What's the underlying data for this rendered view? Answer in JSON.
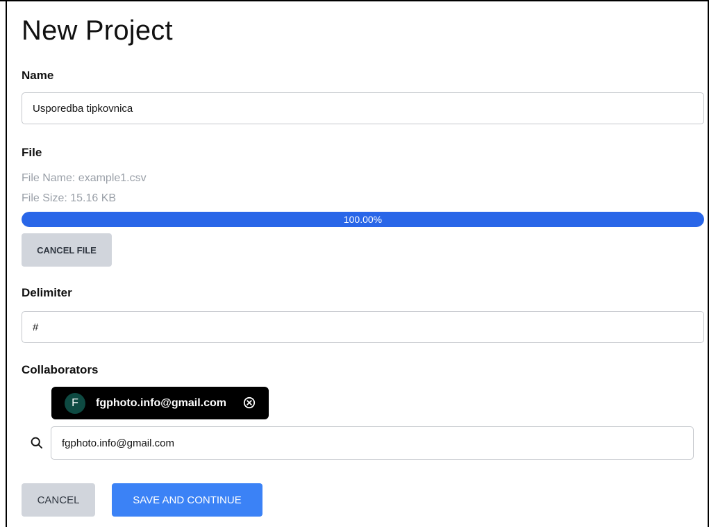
{
  "page": {
    "title": "New Project"
  },
  "name_field": {
    "label": "Name",
    "value": "Usporedba tipkovnica"
  },
  "file": {
    "label": "File",
    "name_line": "File Name: example1.csv",
    "size_line": "File Size: 15.16 KB",
    "progress_percent": 100,
    "progress_label": "100.00%",
    "cancel_label": "CANCEL FILE"
  },
  "delimiter_field": {
    "label": "Delimiter",
    "value": "#"
  },
  "collaborators": {
    "label": "Collaborators",
    "chips": [
      {
        "initial": "F",
        "email": "fgphoto.info@gmail.com"
      }
    ],
    "search_value": "fgphoto.info@gmail.com"
  },
  "actions": {
    "cancel_label": "CANCEL",
    "save_label": "SAVE AND CONTINUE"
  },
  "colors": {
    "primary": "#3b82f6",
    "progress": "#2966e8",
    "chip_bg": "#000000",
    "avatar_bg": "#0e4a42",
    "secondary_button": "#d1d5dc"
  }
}
